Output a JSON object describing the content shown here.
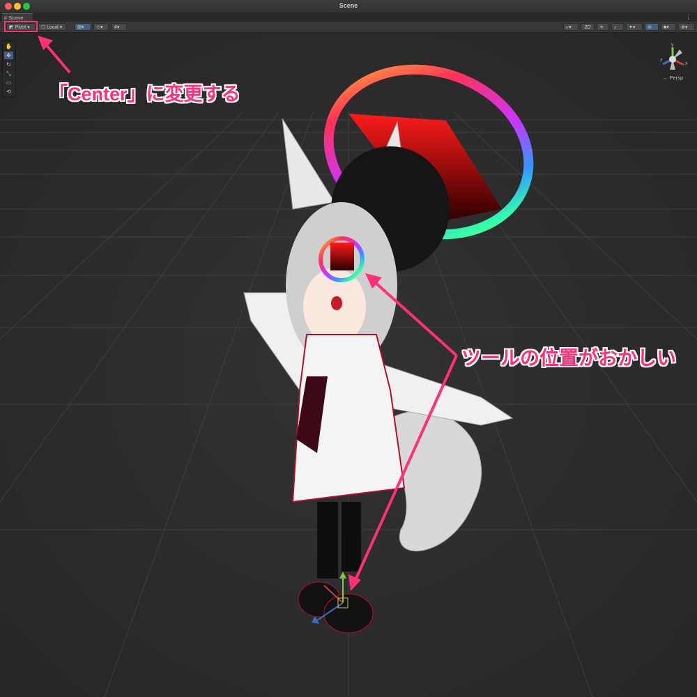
{
  "window": {
    "title": "Scene"
  },
  "tab": {
    "label": "Scene",
    "icon": "hash-icon"
  },
  "toolbar": {
    "pivot_label": "Pivot",
    "local_label": "Local",
    "mode_2d_label": "2D"
  },
  "gizmo": {
    "y_label": "y",
    "z_label": "z",
    "x_label": "x",
    "projection_label": "← Persp"
  },
  "annotations": {
    "pivot_note": "「Center」に変更する",
    "tool_note": "ツールの位置がおかしい"
  },
  "colors": {
    "accent": "#ff2f7a",
    "active_tool": "#46607c",
    "viewport_bg": "#2b2b2b"
  }
}
